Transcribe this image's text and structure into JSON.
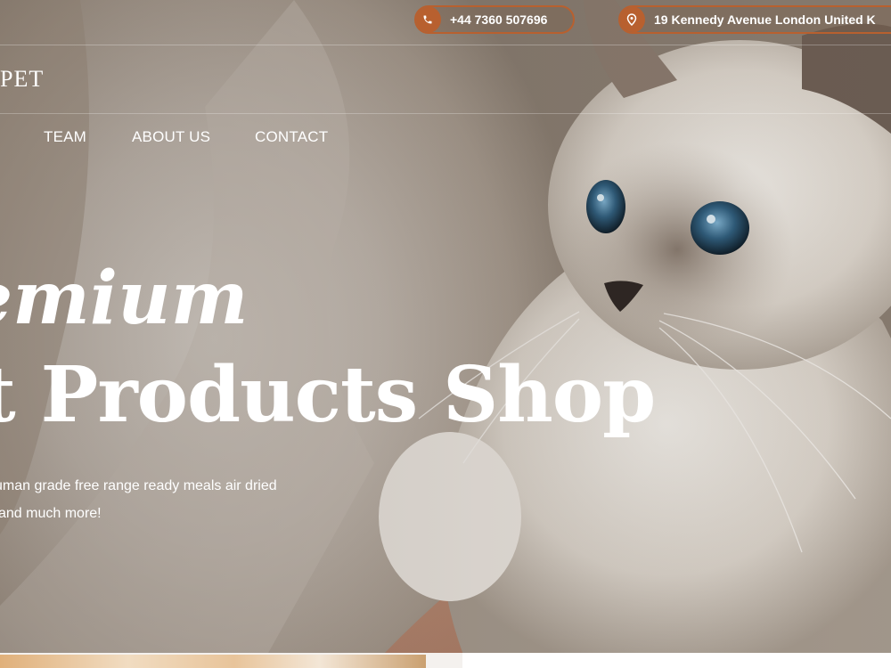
{
  "topbar": {
    "phone": {
      "icon": "phone-icon",
      "text": "+44 7360 507696"
    },
    "address": {
      "icon": "location-pin-icon",
      "text": "19 Kennedy Avenue London United K"
    },
    "accent": "#b8602f"
  },
  "header": {
    "logo_text": "PET",
    "nav": [
      {
        "label": "TEAM"
      },
      {
        "label": "ABOUT US"
      },
      {
        "label": "CONTACT"
      }
    ]
  },
  "hero": {
    "title_line1": "emium",
    "title_line2": "t Products Shop",
    "subtitle_line1": "uman grade free range ready meals air dried",
    "subtitle_line2": "and much more!"
  }
}
